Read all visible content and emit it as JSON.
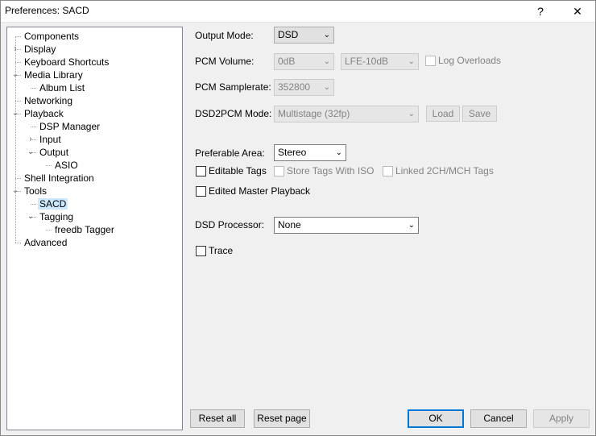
{
  "window": {
    "title": "Preferences: SACD",
    "help_glyph": "?",
    "close_glyph": "✕"
  },
  "tree": {
    "items": [
      {
        "label": "Components",
        "toggle": ""
      },
      {
        "label": "Display",
        "toggle": ">"
      },
      {
        "label": "Keyboard Shortcuts",
        "toggle": ""
      },
      {
        "label": "Media Library",
        "toggle": "v"
      },
      {
        "label": "Album List",
        "toggle": ""
      },
      {
        "label": "Networking",
        "toggle": ""
      },
      {
        "label": "Playback",
        "toggle": "v"
      },
      {
        "label": "DSP Manager",
        "toggle": ""
      },
      {
        "label": "Input",
        "toggle": ">"
      },
      {
        "label": "Output",
        "toggle": "v"
      },
      {
        "label": "ASIO",
        "toggle": ""
      },
      {
        "label": "Shell Integration",
        "toggle": ""
      },
      {
        "label": "Tools",
        "toggle": "v"
      },
      {
        "label": "SACD",
        "toggle": "",
        "selected": true
      },
      {
        "label": "Tagging",
        "toggle": "v"
      },
      {
        "label": "freedb Tagger",
        "toggle": ""
      },
      {
        "label": "Advanced",
        "toggle": ""
      }
    ]
  },
  "settings": {
    "output_mode": {
      "label": "Output Mode:",
      "value": "DSD"
    },
    "pcm_volume": {
      "label": "PCM Volume:",
      "value": "0dB",
      "lfe_value": "LFE-10dB",
      "log_overloads": "Log Overloads"
    },
    "pcm_samplerate": {
      "label": "PCM Samplerate:",
      "value": "352800"
    },
    "dsd2pcm_mode": {
      "label": "DSD2PCM Mode:",
      "value": "Multistage (32fp)",
      "load": "Load",
      "save": "Save"
    },
    "preferable_area": {
      "label": "Preferable Area:",
      "value": "Stereo"
    },
    "editable_tags": "Editable Tags",
    "store_tags_with_iso": "Store Tags With ISO",
    "linked_tags": "Linked 2CH/MCH Tags",
    "edited_master_playback": "Edited Master Playback",
    "dsd_processor": {
      "label": "DSD Processor:",
      "value": "None"
    },
    "trace": "Trace"
  },
  "buttons": {
    "reset_all": "Reset all",
    "reset_page": "Reset page",
    "ok": "OK",
    "cancel": "Cancel",
    "apply": "Apply"
  },
  "icons": {
    "combo_arrow": "⌄",
    "expanded": "⌄",
    "collapsed": "›"
  }
}
